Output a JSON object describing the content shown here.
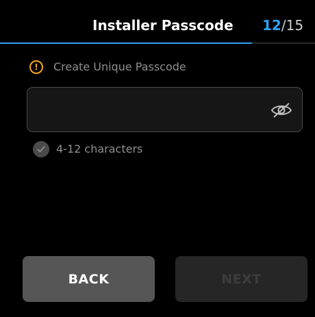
{
  "header": {
    "title": "Installer Passcode",
    "step_current": "12",
    "step_separator": "/",
    "step_total": "15",
    "progress_fraction": 0.8
  },
  "warning": {
    "icon": "exclamation-circle-icon",
    "text": "Create Unique Passcode",
    "color": "#f5a623"
  },
  "passcode_field": {
    "value": "",
    "placeholder": "",
    "visibility_icon": "eye-slash-icon"
  },
  "requirement": {
    "icon": "check-circle-icon",
    "text": "4-12 characters",
    "met": false
  },
  "buttons": {
    "back_label": "BACK",
    "next_label": "NEXT",
    "next_enabled": false
  },
  "colors": {
    "accent": "#2ea3f2",
    "background": "#000000",
    "warning": "#f5a623"
  }
}
